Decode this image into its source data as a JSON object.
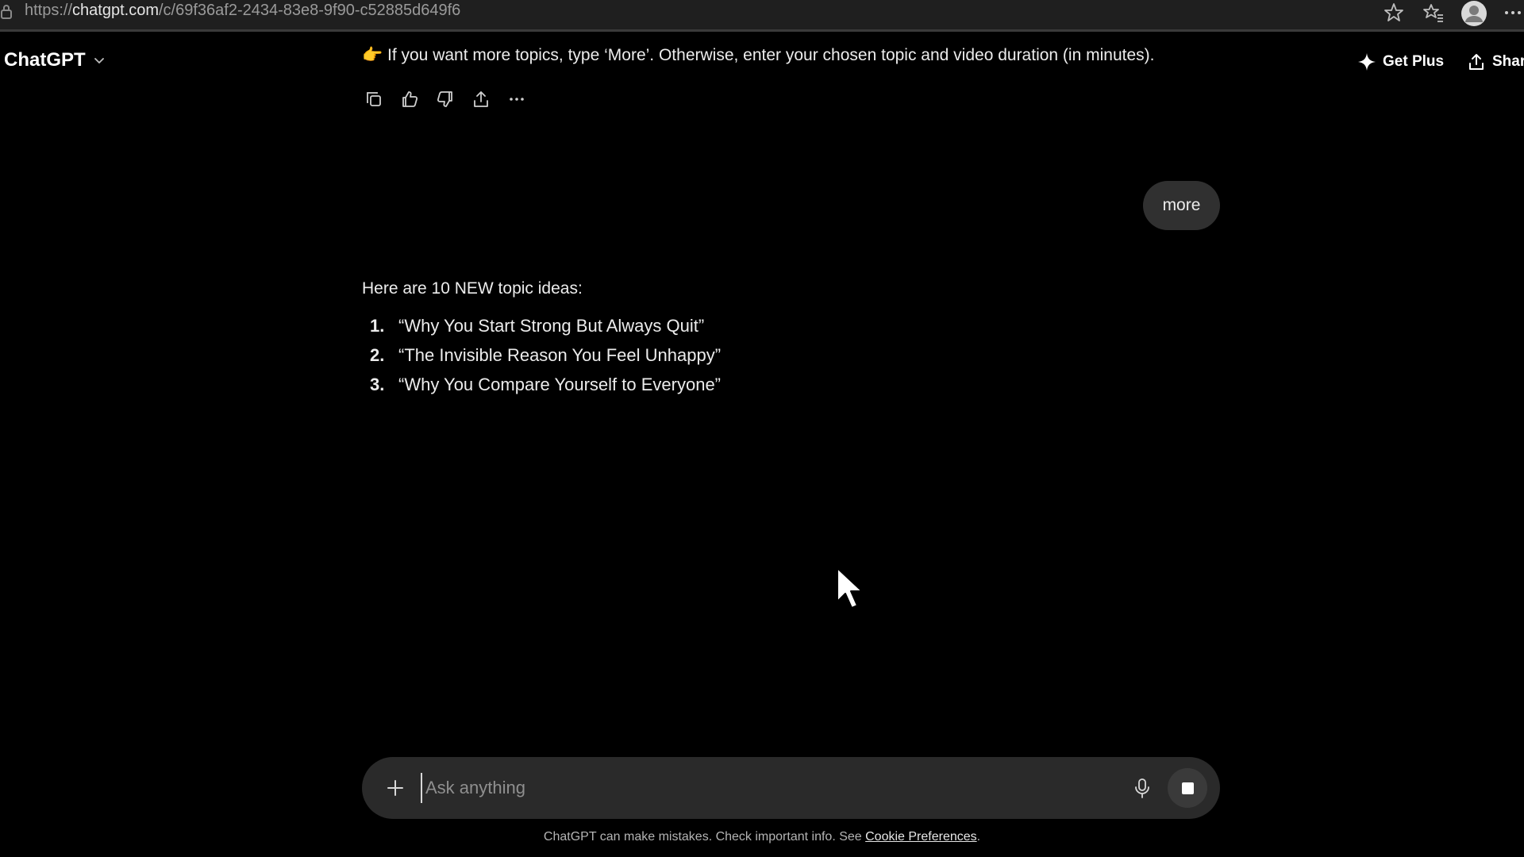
{
  "browser": {
    "url_prefix": "https://",
    "url_host": "chatgpt.com",
    "url_path": "/c/69f36af2-2434-83e8-9f90-c52885d649f6"
  },
  "header": {
    "title": "ChatGPT",
    "get_plus_label": "Get Plus",
    "share_label": "Shar"
  },
  "conversation": {
    "assistant_message": "If you want more topics, type ‘More’. Otherwise, enter your chosen topic and video duration (in minutes).",
    "assistant_emoji": "👉",
    "user_message": "more",
    "reply_intro": "Here are 10 NEW topic ideas:",
    "topics": [
      {
        "num": "1.",
        "text": "“Why You Start Strong But Always Quit”"
      },
      {
        "num": "2.",
        "text": "“The Invisible Reason You Feel Unhappy”"
      },
      {
        "num": "3.",
        "text": "“Why You Compare Yourself to Everyone”"
      }
    ]
  },
  "composer": {
    "placeholder": "Ask anything"
  },
  "footer": {
    "disclaimer": "ChatGPT can make mistakes. Check important info. See ",
    "link_label": "Cookie Preferences",
    "period": "."
  },
  "icons": {
    "action_row": [
      "copy-icon",
      "thumbs-up-icon",
      "thumbs-down-icon",
      "share-icon",
      "more-icon"
    ]
  }
}
